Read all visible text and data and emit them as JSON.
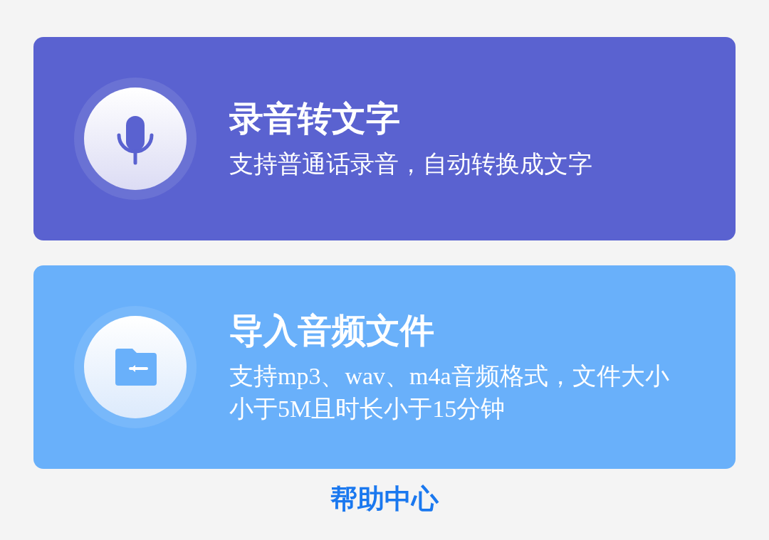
{
  "cards": [
    {
      "kind": "microphone",
      "color": "#5a62d0",
      "title": "录音转文字",
      "description": "支持普通话录音，自动转换成文字"
    },
    {
      "kind": "folder",
      "color": "#69b0fa",
      "title": "导入音频文件",
      "description": "支持mp3、wav、m4a音频格式，文件大小小于5M且时长小于15分钟"
    }
  ],
  "help_link": "帮助中心"
}
